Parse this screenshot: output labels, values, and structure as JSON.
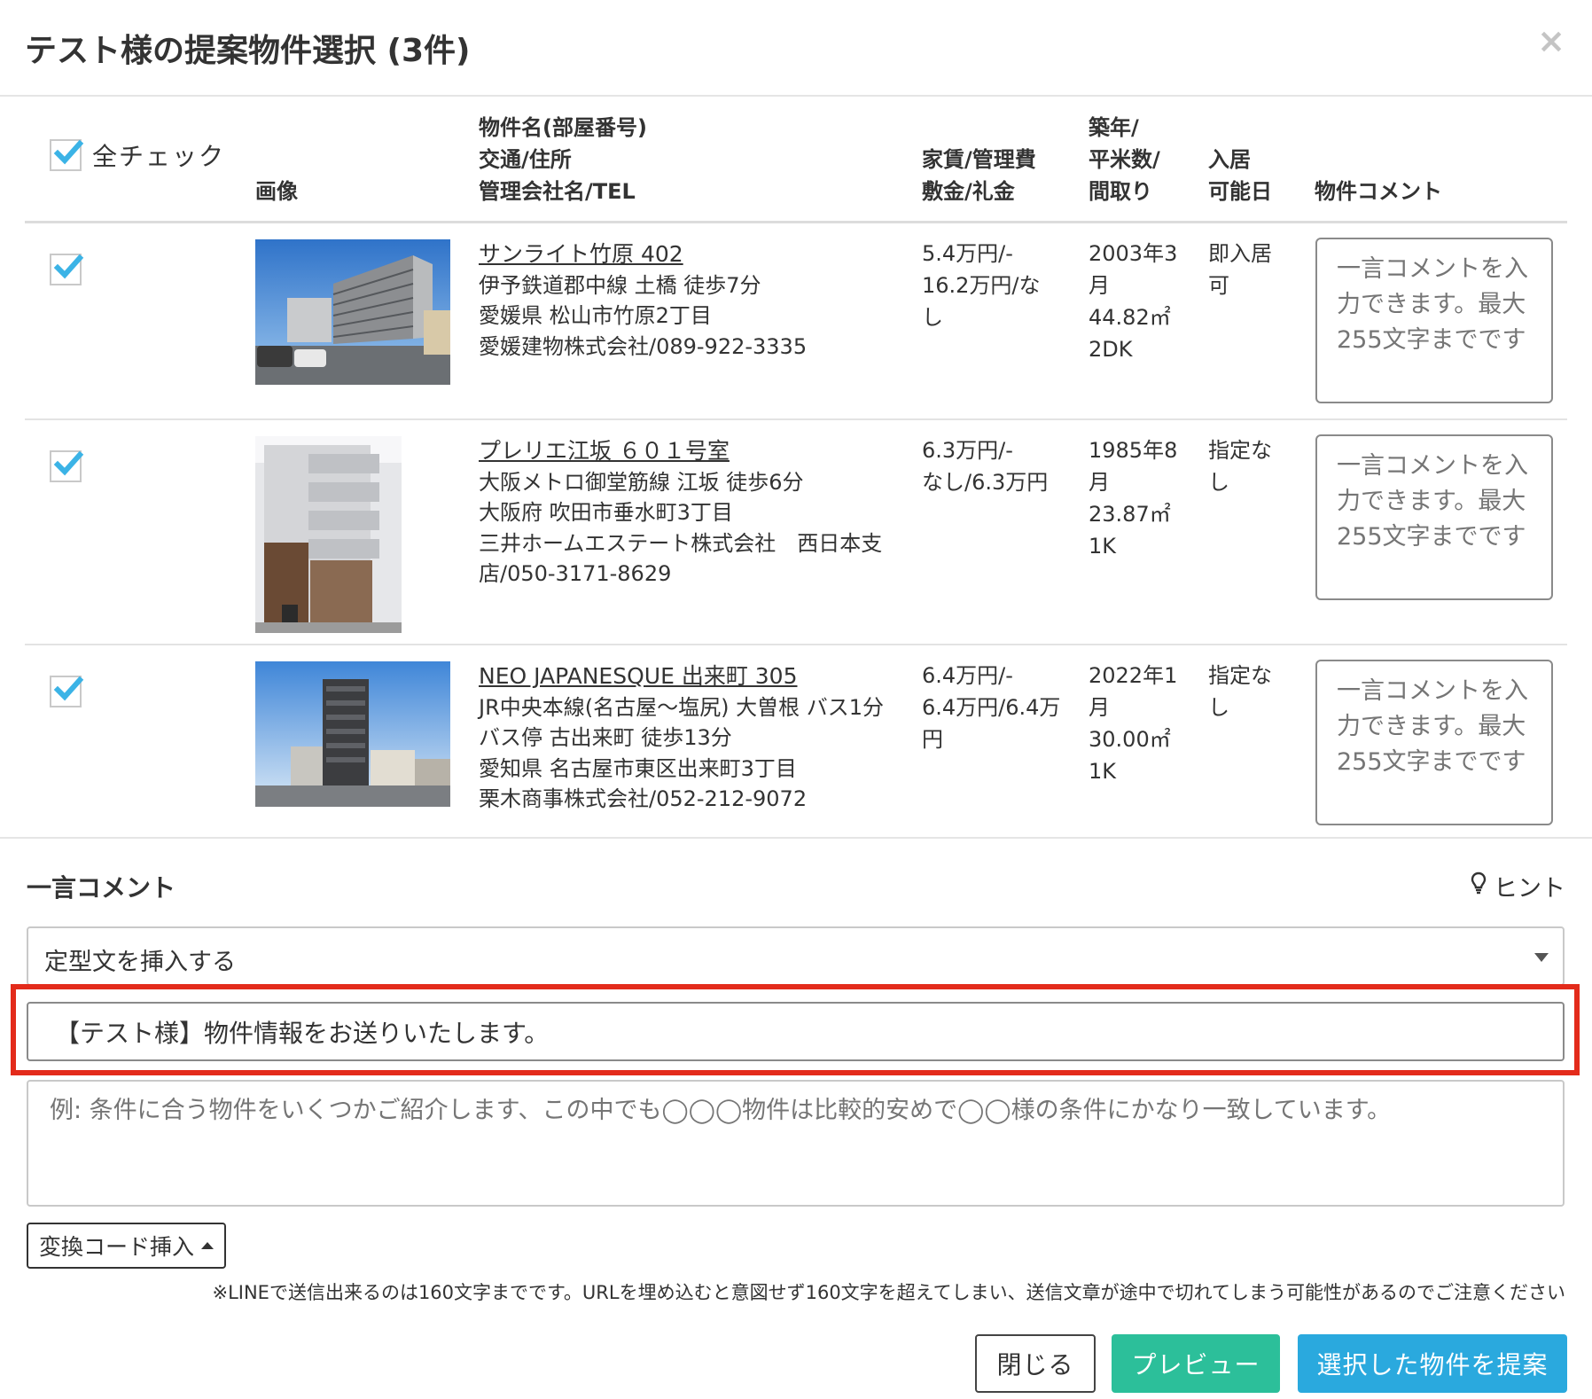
{
  "modal": {
    "title": "テスト様の提案物件選択 (3件)",
    "close": "×"
  },
  "table": {
    "check_all_label": "全チェック",
    "headers": {
      "image": "画像",
      "property": [
        "物件名(部屋番号)",
        "交通/住所",
        "管理会社名/TEL"
      ],
      "rent": [
        "家賃/管理費",
        "敷金/礼金"
      ],
      "specs": [
        "築年/",
        "平米数/",
        "間取り"
      ],
      "move_in": [
        "入居",
        "可能日"
      ],
      "comment": "物件コメント"
    },
    "comment_placeholder": "一言コメントを入力できます。最大255文字までです",
    "rows": [
      {
        "checked": true,
        "name": "サンライト竹原 402",
        "lines": [
          "伊予鉄道郡中線 土橋 徒歩7分",
          "愛媛県 松山市竹原2丁目",
          "愛媛建物株式会社/089-922-3335"
        ],
        "rent": [
          "5.4万円/-",
          "16.2万円/な",
          "し"
        ],
        "specs": [
          "2003年3",
          "月",
          "44.82㎡",
          "2DK"
        ],
        "move_in": [
          "即入居",
          "可"
        ]
      },
      {
        "checked": true,
        "name": "プレリエ江坂 ６０１号室",
        "lines": [
          "大阪メトロ御堂筋線 江坂 徒歩6分",
          "大阪府 吹田市垂水町3丁目",
          "三井ホームエステート株式会社　西日本支",
          "店/050-3171-8629"
        ],
        "rent": [
          "6.3万円/-",
          "なし/6.3万円"
        ],
        "specs": [
          "1985年8",
          "月",
          "23.87㎡",
          "1K"
        ],
        "move_in": [
          "指定な",
          "し"
        ]
      },
      {
        "checked": true,
        "name": "NEO JAPANESQUE 出来町 305",
        "lines": [
          "JR中央本線(名古屋〜塩尻) 大曽根 バス1分",
          "バス停 古出来町 徒歩13分",
          "愛知県 名古屋市東区出来町3丁目",
          "栗木商事株式会社/052-212-9072"
        ],
        "rent": [
          "6.4万円/-",
          "6.4万円/6.4万",
          "円"
        ],
        "specs": [
          "2022年1",
          "月",
          "30.00㎡",
          "1K"
        ],
        "move_in": [
          "指定な",
          "し"
        ]
      }
    ]
  },
  "comment_section": {
    "title": "一言コメント",
    "hint": "ヒント",
    "template_select": "定型文を挿入する",
    "title_value": "【テスト様】物件情報をお送りいたします。",
    "message_placeholder": "例: 条件に合う物件をいくつかご紹介します、この中でも◯◯◯物件は比較的安めで◯◯様の条件にかなり一致しています。",
    "code_button": "変換コード挿入",
    "notice": "※LINEで送信出来るのは160文字までです。URLを埋め込むと意図せず160文字を超えてしまい、送信文章が途中で切れてしまう可能性があるのでご注意ください"
  },
  "buttons": {
    "close": "閉じる",
    "preview": "プレビュー",
    "submit": "選択した物件を提案"
  },
  "colors": {
    "check": "#3bb3e6",
    "preview": "#2cbf9a",
    "submit": "#2aa9de",
    "highlight": "#e32b1b"
  }
}
